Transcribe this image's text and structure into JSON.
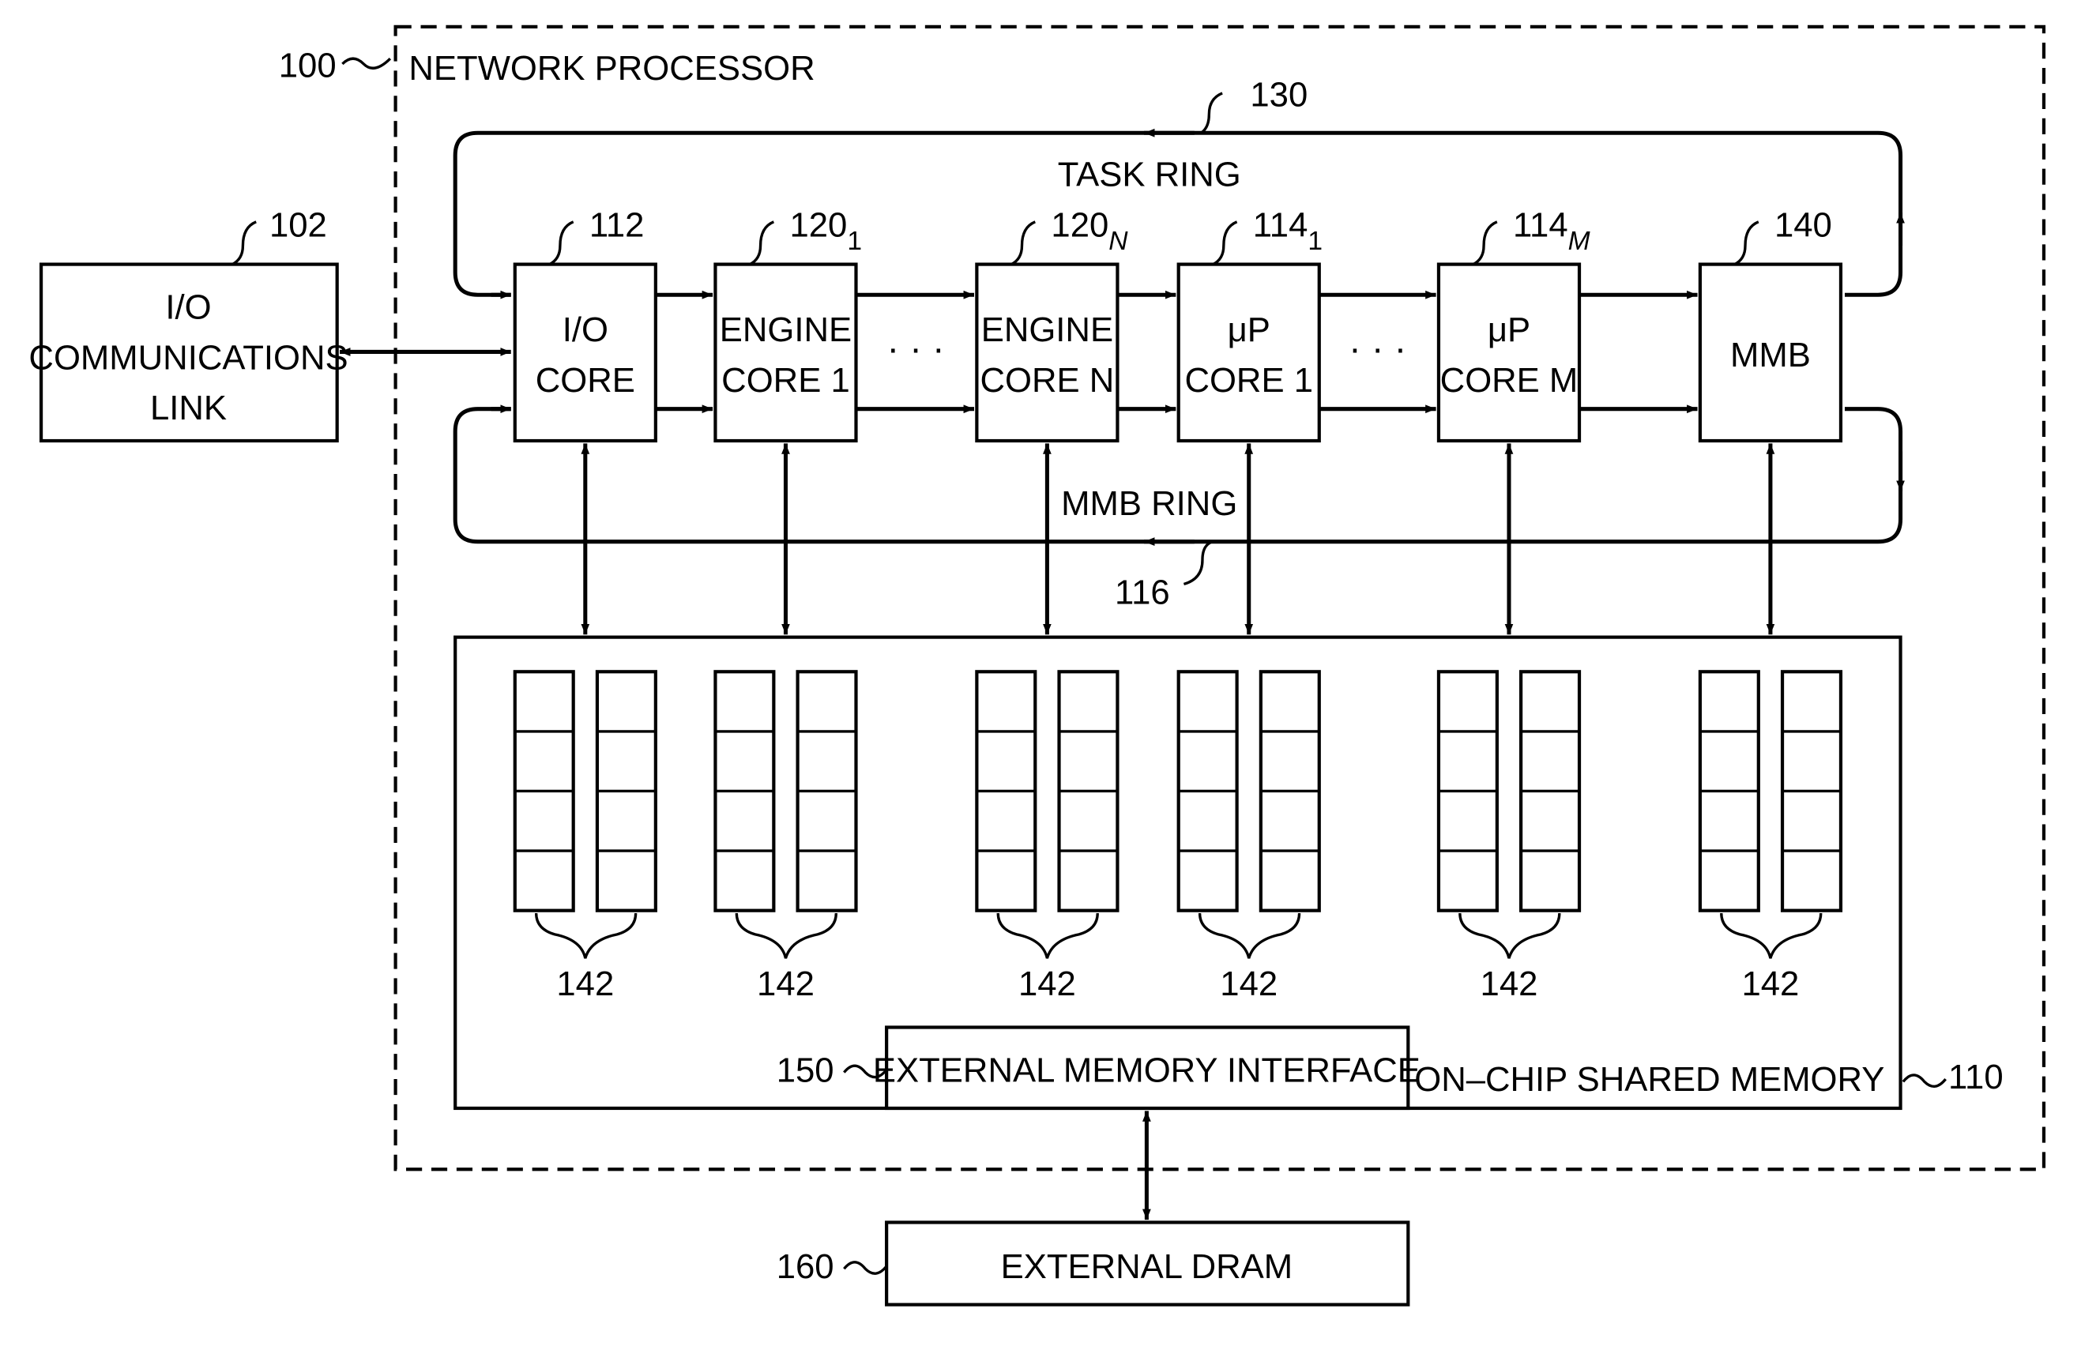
{
  "figure": {
    "network_processor": {
      "ref": "100",
      "label": "NETWORK PROCESSOR"
    },
    "io_link": {
      "ref": "102",
      "lines": [
        "I/O",
        "COMMUNICATIONS",
        "LINK"
      ]
    },
    "task_ring": {
      "ref": "130",
      "label": "TASK RING"
    },
    "mmb_ring": {
      "ref": "116",
      "label": "MMB RING"
    },
    "cores": [
      {
        "ref": "112",
        "sub": "",
        "lines": [
          "I/O",
          "CORE"
        ]
      },
      {
        "ref": "120",
        "sub": "1",
        "lines": [
          "ENGINE",
          "CORE  1"
        ]
      },
      {
        "ref": "120",
        "sub": "N",
        "lines": [
          "ENGINE",
          "CORE  N"
        ]
      },
      {
        "ref": "114",
        "sub": "1",
        "lines": [
          "μP",
          "CORE  1"
        ]
      },
      {
        "ref": "114",
        "sub": "M",
        "lines": [
          "μP",
          "CORE  M"
        ]
      },
      {
        "ref": "140",
        "sub": "",
        "lines": [
          "MMB"
        ]
      }
    ],
    "ellipsis": "· · ·",
    "shared_memory": {
      "ref": "110",
      "label": "ON–CHIP  SHARED  MEMORY"
    },
    "queue_ref": "142",
    "queue_cells": 4,
    "ext_mem_if": {
      "ref": "150",
      "label": "EXTERNAL  MEMORY  INTERFACE"
    },
    "ext_dram": {
      "ref": "160",
      "label": "EXTERNAL  DRAM"
    }
  }
}
